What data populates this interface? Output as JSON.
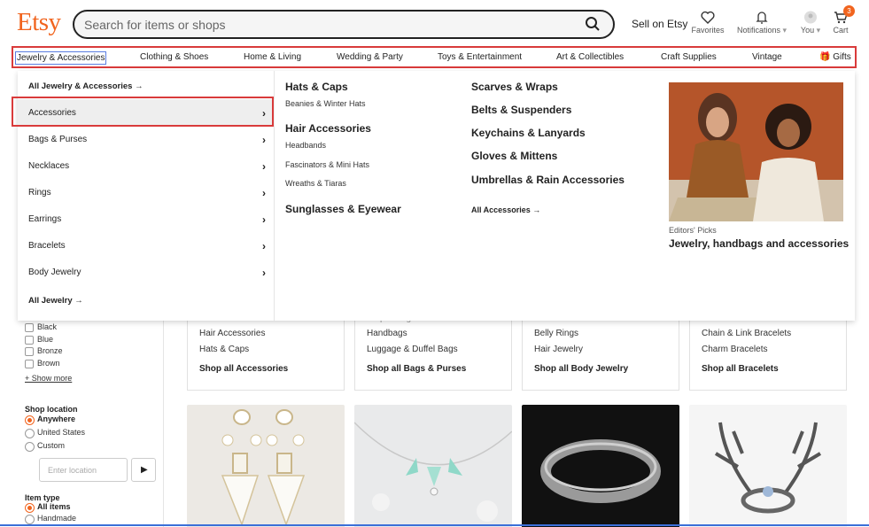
{
  "header": {
    "logo": "Etsy",
    "search_placeholder": "Search for items or shops",
    "sell_on_etsy": "Sell on Etsy",
    "favorites": "Favorites",
    "notifications": "Notifications",
    "you": "You",
    "cart": "Cart",
    "cart_count": "3"
  },
  "nav": {
    "items": [
      "Jewelry & Accessories",
      "Clothing & Shoes",
      "Home & Living",
      "Wedding & Party",
      "Toys & Entertainment",
      "Art & Collectibles",
      "Craft Supplies",
      "Vintage",
      "Gifts"
    ]
  },
  "dropdown": {
    "all_link": "All Jewelry & Accessories",
    "categories": [
      "Accessories",
      "Bags & Purses",
      "Necklaces",
      "Rings",
      "Earrings",
      "Bracelets",
      "Body Jewelry"
    ],
    "all_jewelry": "All Jewelry",
    "col2": {
      "h1": "Hats & Caps",
      "i1": "Beanies & Winter Hats",
      "h2": "Hair Accessories",
      "i2": "Headbands",
      "i3": "Fascinators & Mini Hats",
      "i4": "Wreaths & Tiaras",
      "h3": "Sunglasses & Eyewear"
    },
    "col3": {
      "h1": "Scarves & Wraps",
      "h2": "Belts & Suspenders",
      "h3": "Keychains & Lanyards",
      "h4": "Gloves & Mittens",
      "h5": "Umbrellas & Rain Accessories",
      "all": "All Accessories"
    },
    "editors": {
      "label": "Editors' Picks",
      "title": "Jewelry, handbags and accessories"
    }
  },
  "sidebar": {
    "colors": [
      "Black",
      "Blue",
      "Bronze",
      "Brown"
    ],
    "show_more": "+ Show more",
    "shop_location": "Shop location",
    "locations": [
      "Anywhere",
      "United States",
      "Custom"
    ],
    "location_placeholder": "Enter location",
    "item_type": "Item type",
    "item_types": [
      "All items",
      "Handmade"
    ]
  },
  "cards": [
    {
      "partial": "Gloves & Mittens",
      "lines": [
        "Hair Accessories",
        "Hats & Caps"
      ],
      "shop": "Shop all Accessories"
    },
    {
      "partial": "Diaper Bags",
      "lines": [
        "Handbags",
        "Luggage & Duffel Bags"
      ],
      "shop": "Shop all Bags & Purses"
    },
    {
      "partial": "Arm Bands",
      "lines": [
        "Belly Rings",
        "Hair Jewelry"
      ],
      "shop": "Shop all Body Jewelry"
    },
    {
      "partial": "Beaded Bracelets",
      "lines": [
        "Chain & Link Bracelets",
        "Charm Bracelets"
      ],
      "shop": "Shop all Bracelets"
    }
  ],
  "colors": {
    "brand": "#F1641E",
    "highlight": "#d93b3b",
    "selection": "#5b7de0"
  }
}
